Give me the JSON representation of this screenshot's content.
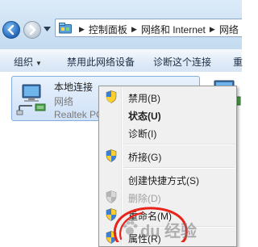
{
  "address": {
    "crumbs": [
      "控制面板",
      "网络和 Internet",
      "网络"
    ]
  },
  "toolbar": {
    "organize": "组织",
    "disable_device": "禁用此网络设备",
    "diagnose": "诊断这个连接",
    "rename_truncated": "重"
  },
  "connection": {
    "name": "本地连接",
    "network": "网络",
    "adapter": "Realtek PC"
  },
  "menu": {
    "items": [
      {
        "label": "禁用(B)",
        "icon": "shield-icon"
      },
      {
        "label": "状态(U)",
        "bold": true
      },
      {
        "label": "诊断(I)"
      },
      {
        "label": "桥接(G)",
        "icon": "shield-icon"
      },
      {
        "label": "创建快捷方式(S)"
      },
      {
        "label": "删除(D)",
        "icon": "shield-icon",
        "disabled": true
      },
      {
        "label": "重命名(M)",
        "icon": "shield-icon"
      },
      {
        "label": "属性(R)",
        "icon": "shield-icon"
      }
    ]
  },
  "watermark": {
    "text": "du 经验"
  },
  "colors": {
    "accent": "#2366b8",
    "selection": "#cfe1f8",
    "menu_bg": "#f0f0f0",
    "annotation": "#e8231a"
  }
}
